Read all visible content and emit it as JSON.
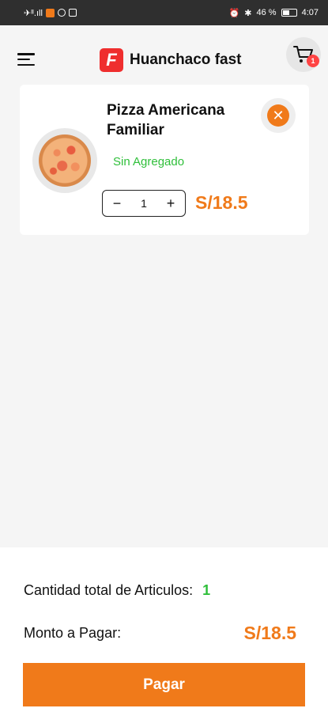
{
  "status_bar": {
    "left_text": "✈ᴵᴵ.ıll",
    "battery_text": "46 %",
    "time": "4:07"
  },
  "header": {
    "brand_logo_letter": "F",
    "brand_name": "Huanchaco fast",
    "cart_count": "1"
  },
  "cart": {
    "items": [
      {
        "name": "Pizza Americana Familiar",
        "addon": "Sin Agregado",
        "quantity": "1",
        "decrement": "−",
        "increment": "+",
        "price": "S/18.5",
        "remove_symbol": "✕"
      }
    ]
  },
  "summary": {
    "count_label": "Cantidad total de Articulos:",
    "count_value": "1",
    "amount_label": "Monto a Pagar:",
    "amount_value": "S/18.5",
    "pay_label": "Pagar"
  },
  "colors": {
    "accent": "#f07a1a",
    "success": "#2fbf3a",
    "brand_red": "#ef2e2e",
    "status_bar": "#2f2f2f"
  },
  "icons": {
    "menu": "hamburger-icon",
    "cart": "shopping-cart-icon",
    "remove": "close-icon"
  }
}
